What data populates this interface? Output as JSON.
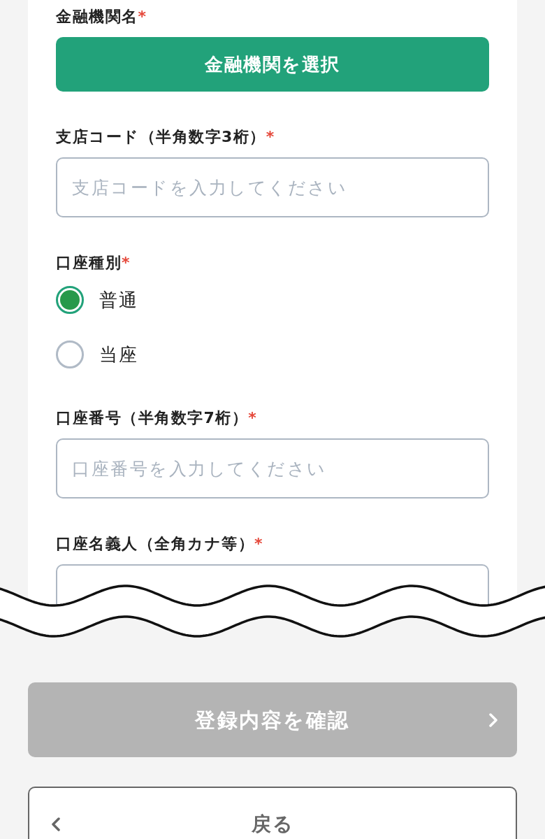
{
  "form": {
    "fields": [
      {
        "kind": "select_button",
        "label": "金融機関名",
        "required_mark": "*",
        "button": "金融機関を選択"
      },
      {
        "kind": "text",
        "label": "支店コード（半角数字3桁）",
        "required_mark": "*",
        "placeholder": "支店コードを入力してください"
      },
      {
        "kind": "radio",
        "label": "口座種別",
        "required_mark": "*",
        "options": [
          {
            "label": "普通",
            "selected": true
          },
          {
            "label": "当座",
            "selected": false
          }
        ]
      },
      {
        "kind": "text",
        "label": "口座番号（半角数字7桁）",
        "required_mark": "*",
        "placeholder": "口座番号を入力してください"
      },
      {
        "kind": "text",
        "label": "口座名義人（全角カナ等）",
        "required_mark": "*"
      }
    ]
  },
  "confirm_button": {
    "label": "登録内容を確認",
    "disabled": true
  },
  "back_button": {
    "label": "戻る"
  }
}
